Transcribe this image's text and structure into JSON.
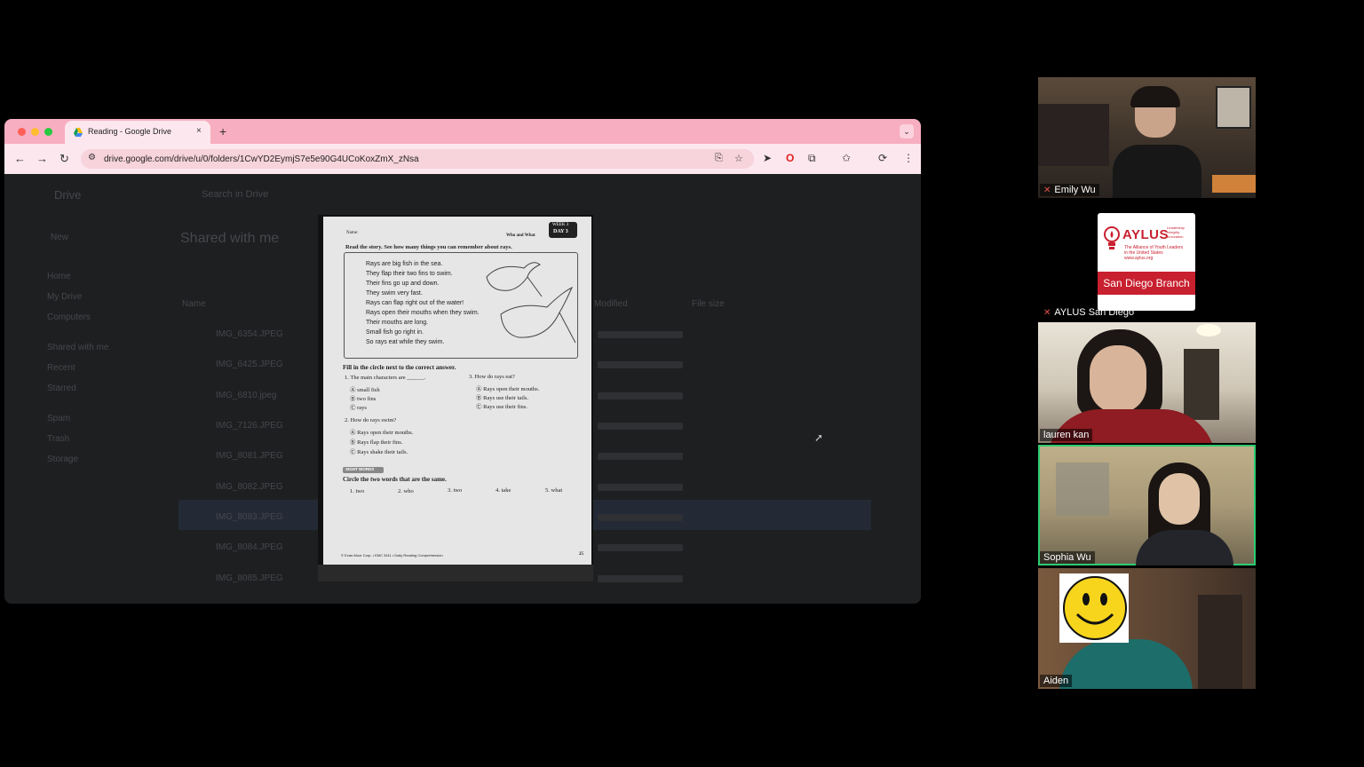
{
  "browser": {
    "tab_title": "Reading - Google Drive",
    "new_tab": "+",
    "tab_close": "×",
    "url": "drive.google.com/drive/u/0/folders/1CwYD2EymjS7e5e90G4UCoKoxZmX_zNsa"
  },
  "drive": {
    "logo": "Drive",
    "search_placeholder": "Search in Drive",
    "new_button": "New",
    "heading": "Shared with me",
    "sidebar": [
      "Home",
      "My Drive",
      "Computers",
      "Shared with me",
      "Recent",
      "Starred",
      "Spam",
      "Trash",
      "Storage"
    ],
    "col_name": "Name",
    "col_modified": "Modified",
    "col_size": "File size",
    "files": [
      "IMG_6354.JPEG",
      "IMG_6425.JPEG",
      "IMG_6810.jpeg",
      "IMG_7126.JPEG",
      "IMG_8081.JPEG",
      "IMG_8082.JPEG",
      "IMG_8083.JPEG",
      "IMG_8084.JPEG",
      "IMG_8085.JPEG"
    ]
  },
  "worksheet": {
    "name_label": "Name:",
    "topic": "Who and What",
    "week": "WEEK 3",
    "day": "DAY 3",
    "instruction": "Read the story. See how many things you can remember about rays.",
    "story": [
      "Rays are big fish in the sea.",
      "They flap their two fins to swim.",
      "Their fins go up and down.",
      "They swim very fast.",
      "Rays can flap right out of the water!",
      "Rays open their mouths when they swim.",
      "Their mouths are long.",
      "Small fish go right in.",
      "So rays eat while they swim."
    ],
    "fill_instruction": "Fill in the circle next to the correct answer.",
    "q1": "1. The main characters are ______.",
    "q1_options": [
      "Ⓐ small fish",
      "Ⓑ two fins",
      "Ⓒ rays"
    ],
    "q2": "2. How do rays swim?",
    "q2_options": [
      "Ⓐ Rays open their mouths.",
      "Ⓑ Rays flap their fins.",
      "Ⓒ Rays shake their tails."
    ],
    "q3": "3. How do rays eat?",
    "q3_options": [
      "Ⓐ Rays open their mouths.",
      "Ⓑ Rays use their tails.",
      "Ⓒ Rays use their fins."
    ],
    "sight_words": "SIGHT WORDS",
    "circle_instruction": "Circle the two words that are the same.",
    "words": [
      "1. two",
      "2. who",
      "3. two",
      "4. take",
      "5. what"
    ],
    "footer": "© Evan-Moor Corp. • EMC 3411 • Daily Reading Comprehension",
    "page": "25"
  },
  "participants": [
    {
      "name": "Emily Wu",
      "muted": true
    },
    {
      "name": "AYLUS San Diego",
      "muted": true
    },
    {
      "name": "lauren kan",
      "muted": false
    },
    {
      "name": "Sophia Wu",
      "muted": false,
      "speaking": true
    },
    {
      "name": "Aiden",
      "muted": false
    }
  ],
  "aylus_logo": {
    "title": "AYLUS",
    "subtitle_lines": [
      "The Alliance of Youth Leaders",
      "in the United States",
      "www.aylus.org"
    ],
    "values": [
      "Leadership",
      "Integrity",
      "Innovation"
    ],
    "branch": "San Diego Branch"
  },
  "colors": {
    "tab_bar": "#f7aec0",
    "toolbar": "#fde7ee",
    "speaking_border": "#2ecc71",
    "aylus_red": "#c8202f"
  },
  "icons": [
    "google-drive-icon",
    "back-arrow-icon",
    "forward-arrow-icon",
    "reload-icon",
    "site-settings-icon",
    "install-icon",
    "bookmark-star-icon",
    "cursor-icon",
    "opera-icon",
    "extensions-icon",
    "bookmarks-icon",
    "sync-icon",
    "menu-dots-icon",
    "muted-mic-icon",
    "smiley-face-icon"
  ]
}
